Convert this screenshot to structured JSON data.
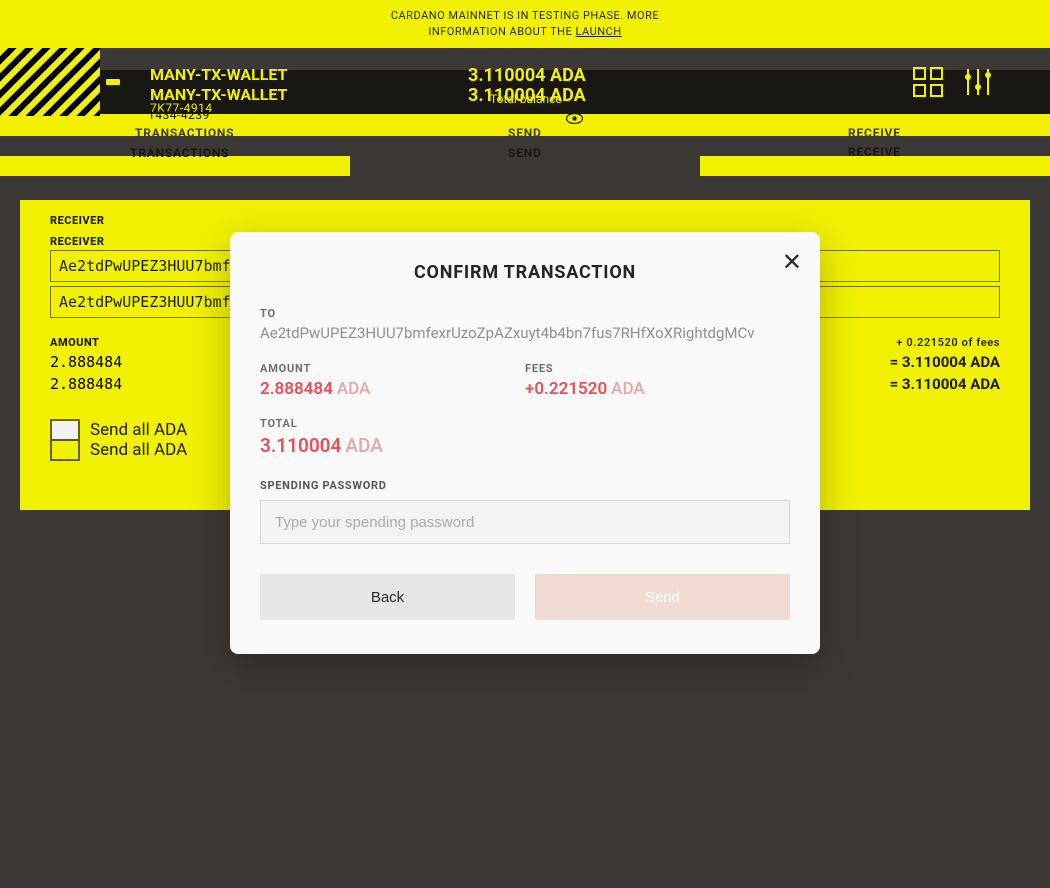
{
  "banner": {
    "line1": "CARDANO MAINNET IS IN TESTING PHASE. MORE",
    "line2_prefix": "INFORMATION ABOUT THE ",
    "line2_link": "LAUNCH"
  },
  "wallet": {
    "name": "MANY-TX-WALLET",
    "sub1": "7K77-4914",
    "sub2": "1434-4239",
    "balance": "3.110004 ADA",
    "balanceLabel": "Total balance"
  },
  "tabs": {
    "transactions": "TRANSACTIONS",
    "send": "SEND",
    "receive": "RECEIVE"
  },
  "form": {
    "receiverLabel": "RECEIVER",
    "receiverValue": "Ae2tdPwUPEZ3HUU7bmfe",
    "amountLabel": "AMOUNT",
    "amountValue": "2.888484",
    "feesLabel": "+ 0.221520 of fees",
    "adaEquals": "= 3.110004 ADA",
    "sendAll": "Send all ADA"
  },
  "modal": {
    "title": "CONFIRM TRANSACTION",
    "toLabel": "TO",
    "toValue": "Ae2tdPwUPEZ3HUU7bmfexrUzoZpAZxuyt4b4bn7fus7RHfXoXRightdgMCv",
    "amountLabel": "AMOUNT",
    "amountValue": "2.888484",
    "feesLabel": "FEES",
    "feesValue": "+0.221520",
    "totalLabel": "TOTAL",
    "totalValue": "3.110004",
    "unit": "ADA",
    "pwLabel": "SPENDING PASSWORD",
    "pwPlaceholder": "Type your spending password",
    "backBtn": "Back",
    "sendBtn": "Send"
  }
}
